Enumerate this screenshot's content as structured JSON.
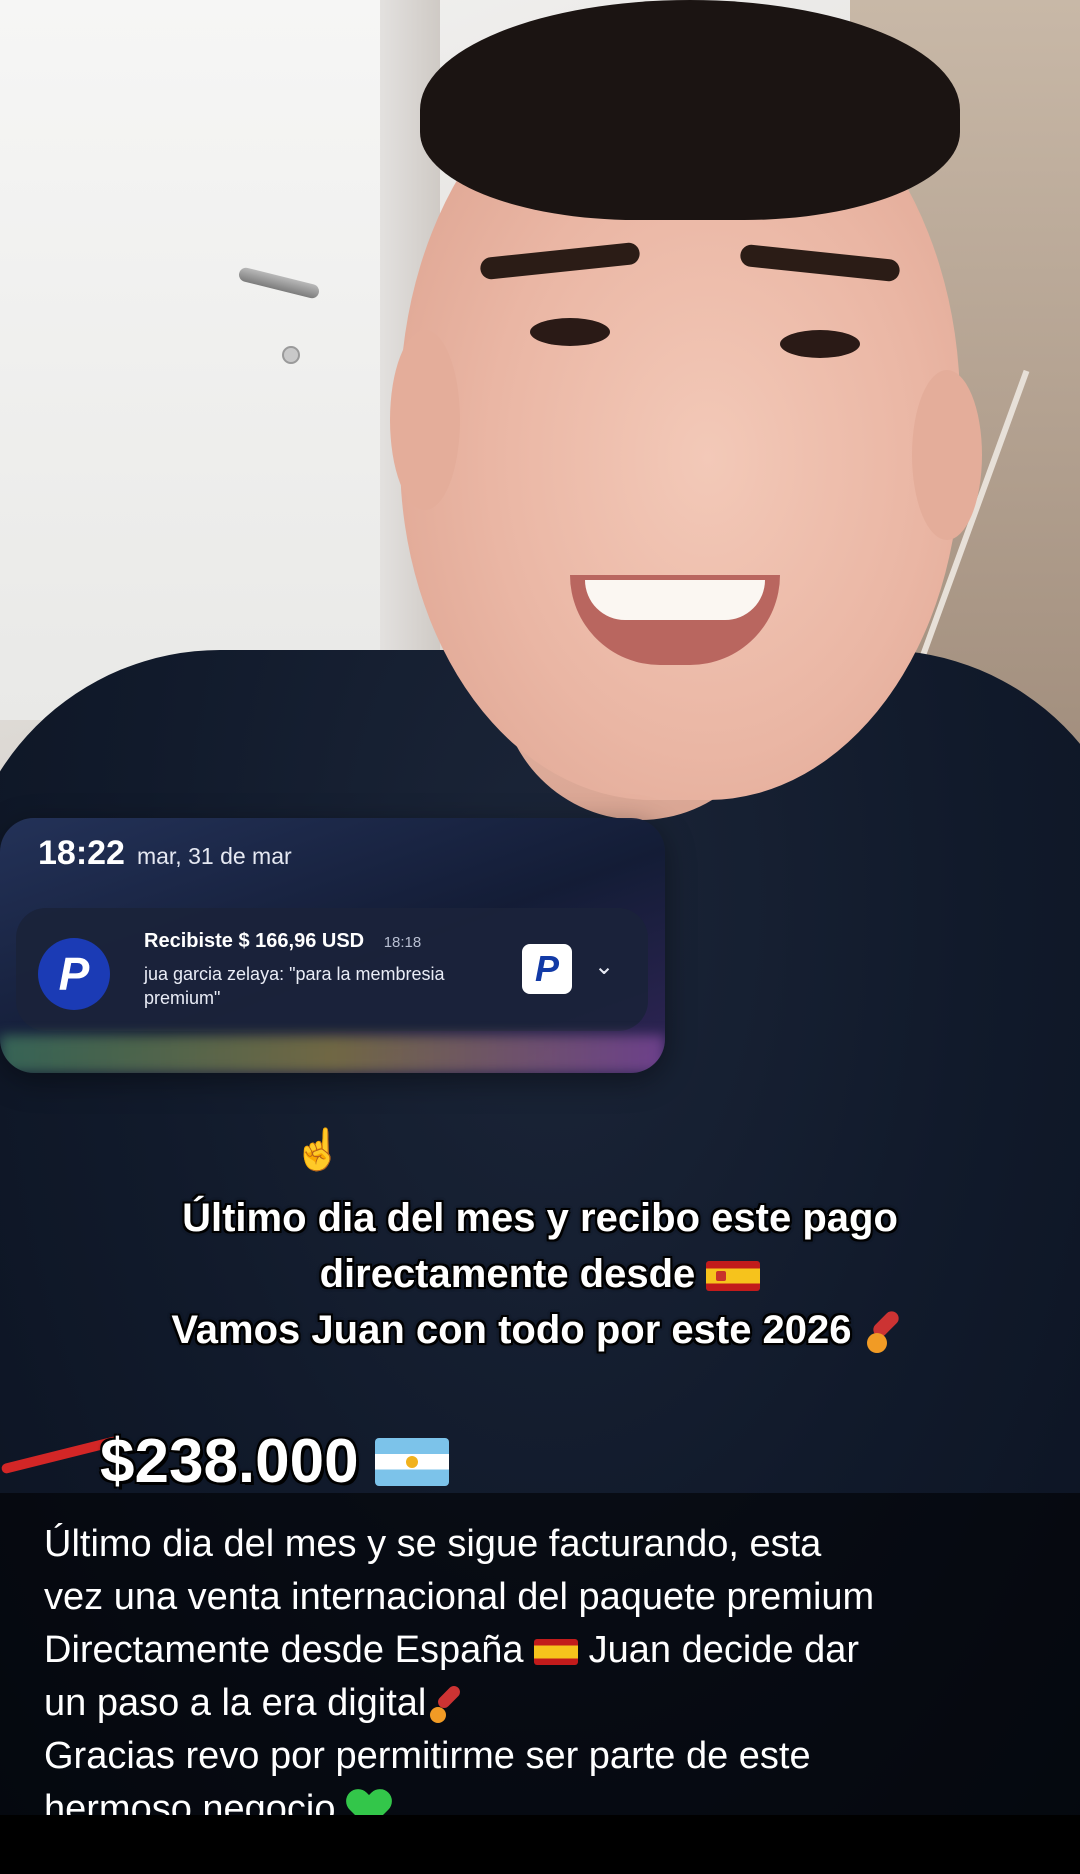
{
  "notification": {
    "time": "18:22",
    "date": "mar, 31 de mar",
    "app_icon": "paypal-icon",
    "title": "Recibiste $ 166,96 USD",
    "timestamp": "18:18",
    "body": "jua garcia zelaya: \"para la membresia premium\"",
    "expand_icon": "chevron-down-icon"
  },
  "caption": {
    "line1": "Último dia del mes y recibo este pago",
    "line2": "directamente desde",
    "line3": "Vamos Juan con todo por este 2026"
  },
  "amount": {
    "value": "$238.000"
  },
  "description": {
    "line1": "Último dia del mes y se sigue facturando, esta",
    "line2": "vez una venta internacional del paquete premium",
    "line3a": "Directamente desde España",
    "line3b": "Juan decide dar",
    "line4": "un paso a la era digital",
    "line5": "Gracias revo por permitirme ser parte de este",
    "line6": "hermoso negocio"
  },
  "colors": {
    "notification_bg": "#1a233a",
    "paypal_blue": "#1b3bb5",
    "heart_green": "#33c64a"
  }
}
